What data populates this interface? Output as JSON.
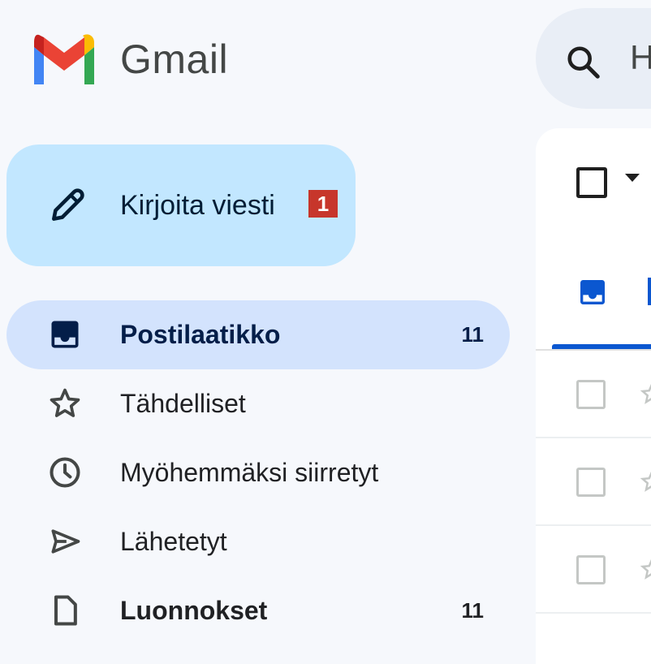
{
  "app": {
    "brand": "Gmail",
    "accent_color": "#0b57d0"
  },
  "search": {
    "placeholder_visible": "H",
    "icon": "search-icon"
  },
  "compose": {
    "label": "Kirjoita viesti",
    "icon": "pencil-icon",
    "marker": "1"
  },
  "nav": {
    "items": [
      {
        "label": "Postilaatikko",
        "count": "11",
        "icon": "inbox-icon",
        "active": true,
        "bold": true
      },
      {
        "label": "Tähdelliset",
        "count": "",
        "icon": "star-icon",
        "active": false,
        "bold": false
      },
      {
        "label": "Myöhemmäksi siirretyt",
        "count": "",
        "icon": "clock-icon",
        "active": false,
        "bold": false
      },
      {
        "label": "Lähetetyt",
        "count": "",
        "icon": "send-icon",
        "active": false,
        "bold": false
      },
      {
        "label": "Luonnokset",
        "count": "11",
        "icon": "draft-icon",
        "active": false,
        "bold": true
      }
    ]
  }
}
